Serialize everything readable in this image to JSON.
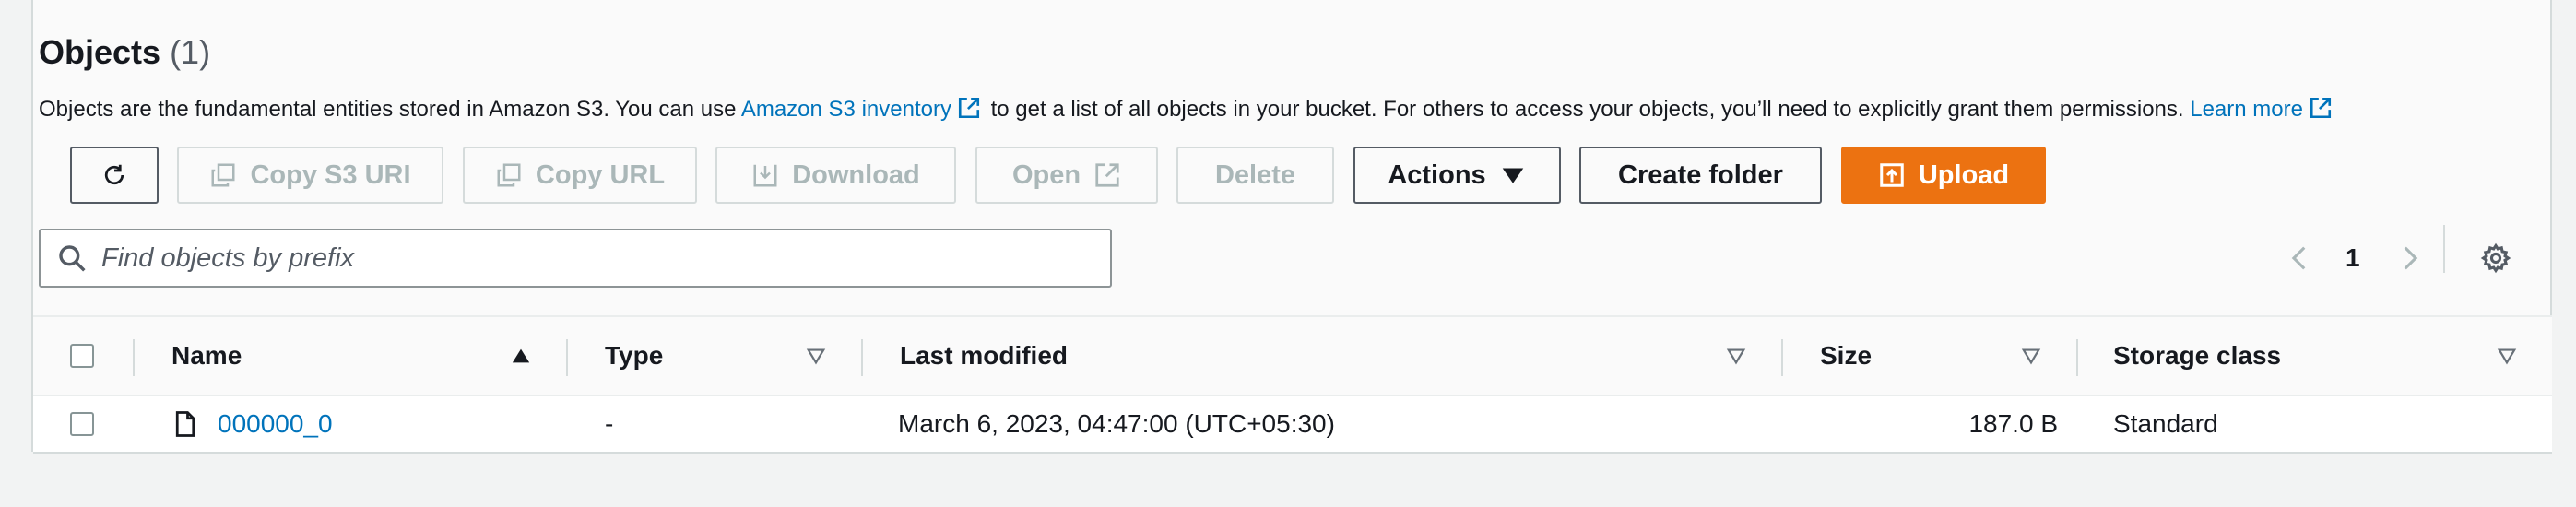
{
  "header": {
    "title": "Objects",
    "count": "(1)",
    "description_before": "Objects are the fundamental entities stored in Amazon S3. You can use ",
    "inventory_link": "Amazon S3 inventory",
    "description_middle": " to get a list of all objects in your bucket. For others to access your objects, you’ll need to explicitly grant them permissions. ",
    "learn_more": "Learn more"
  },
  "toolbar": {
    "copy_s3_uri": "Copy S3 URI",
    "copy_url": "Copy URL",
    "download": "Download",
    "open": "Open",
    "delete": "Delete",
    "actions": "Actions",
    "create_folder": "Create folder",
    "upload": "Upload"
  },
  "search": {
    "placeholder": "Find objects by prefix",
    "value": ""
  },
  "pagination": {
    "current_page": "1"
  },
  "table": {
    "columns": [
      "Name",
      "Type",
      "Last modified",
      "Size",
      "Storage class"
    ],
    "rows": [
      {
        "name": "000000_0",
        "type": "-",
        "last_modified": "March 6, 2023, 04:47:00 (UTC+05:30)",
        "size": "187.0 B",
        "storage_class": "Standard"
      }
    ]
  },
  "colors": {
    "link": "#0073bb",
    "primary": "#ec7211",
    "disabled": "#aab7b8"
  }
}
